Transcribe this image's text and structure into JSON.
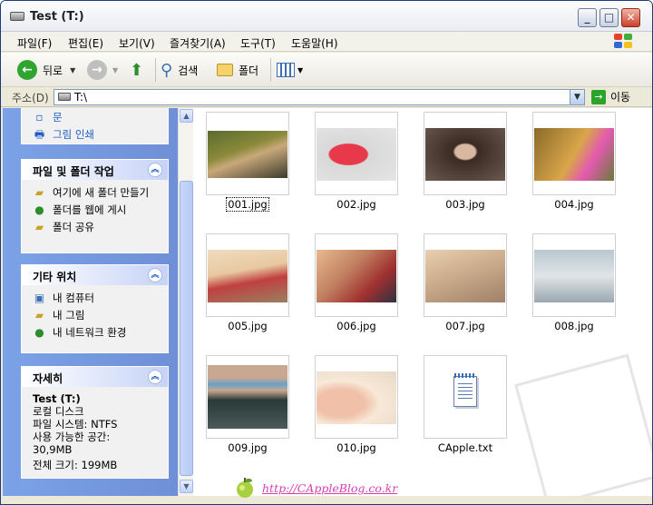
{
  "window": {
    "title": "Test (T:)"
  },
  "menu": [
    "파일(F)",
    "편집(E)",
    "보기(V)",
    "즐겨찾기(A)",
    "도구(T)",
    "도움말(H)"
  ],
  "toolbar": {
    "back": "뒤로",
    "search": "검색",
    "folders": "폴더"
  },
  "address": {
    "label": "주소(D)",
    "value": "T:\\",
    "go": "이동"
  },
  "taskpane": {
    "top_links": [
      "문",
      "그림 인쇄"
    ],
    "file_tasks": {
      "title": "파일 및 폴더 작업",
      "links": [
        "여기에 새 폴더 만들기",
        "폴더를 웹에 게시",
        "폴더 공유"
      ]
    },
    "other_places": {
      "title": "기타 위치",
      "links": [
        "내 컴퓨터",
        "내 그림",
        "내 네트워크 환경"
      ]
    },
    "details": {
      "title": "자세히",
      "name": "Test (T:)",
      "type": "로컬 디스크",
      "fs": "파일 시스템: NTFS",
      "free_label": "사용 가능한 공간:",
      "free_value": "30,9MB",
      "total": "전체 크기: 199MB"
    }
  },
  "files": [
    "001.jpg",
    "002.jpg",
    "003.jpg",
    "004.jpg",
    "005.jpg",
    "006.jpg",
    "007.jpg",
    "008.jpg",
    "009.jpg",
    "010.jpg",
    "CApple.txt"
  ],
  "credit": "http://CAppleBlog.co.kr",
  "colors": {
    "taskpane": "#7ba2e7",
    "link": "#215dc6",
    "credit": "#d43fb0"
  }
}
